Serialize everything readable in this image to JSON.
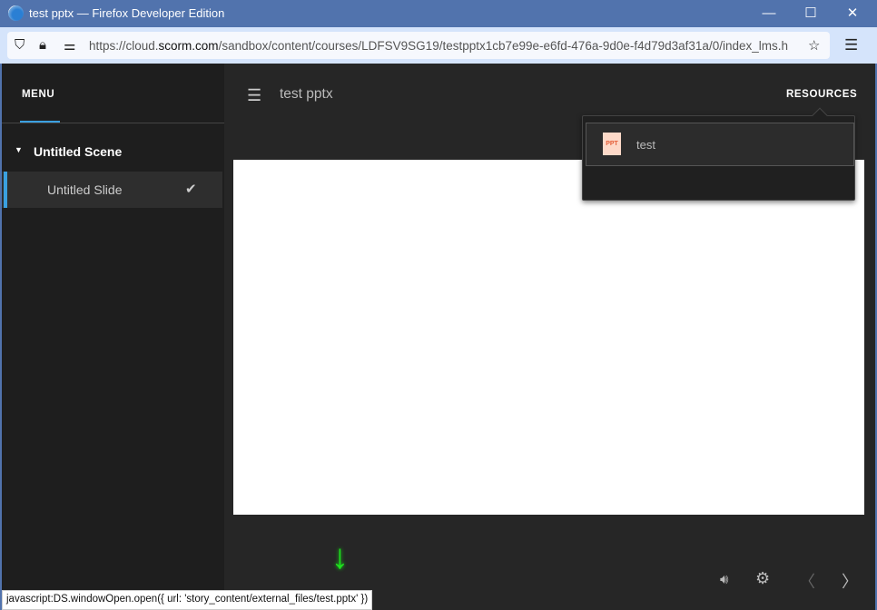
{
  "window": {
    "title": "test pptx — Firefox Developer Edition",
    "minimize": "—",
    "maximize": "☐",
    "close": "✕"
  },
  "browser": {
    "url_pre": "https://cloud.",
    "url_domain": "scorm.com",
    "url_post": "/sandbox/content/courses/LDFSV9SG19/testpptx1cb7e99e-e6fd-476a-9d0e-f4d79d3af31a/0/index_lms.h"
  },
  "sidebar": {
    "menu_label": "MENU",
    "scene": "Untitled Scene",
    "slides": [
      {
        "label": "Untitled Slide",
        "completed": true
      }
    ]
  },
  "header": {
    "course_title": "test pptx",
    "resources_label": "RESOURCES"
  },
  "resources": {
    "items": [
      {
        "icon": "PPT",
        "label": "test"
      }
    ]
  },
  "status_bar": "javascript:DS.windowOpen.open({ url: 'story_content/external_files/test.pptx' })",
  "colors": {
    "accent": "#3aa0e0",
    "titlebar": "#5173ad"
  }
}
